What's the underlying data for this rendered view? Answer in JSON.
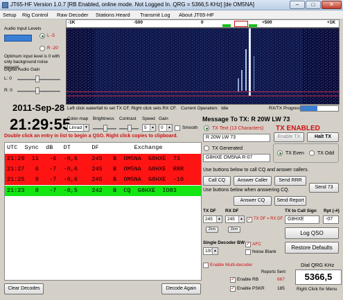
{
  "window": {
    "title": "JT65-HF Version 1.0.7  [RB Enabled, online mode.  Not Logged In.  QRG = 5366,5 KHz] [de OM5NA]",
    "minimize": "‒",
    "maximize": "□",
    "close": "✕"
  },
  "menu": [
    "Setup",
    "Rig Control",
    "Raw Decoder",
    "Stations Heard",
    "Transmit Log",
    "About JT65-HF"
  ],
  "audio": {
    "section_label": "Audio Input Levels",
    "left_label": "L -5",
    "right_label": "R -20",
    "hint": "Optimum input level is 0 with only background noise present.",
    "digital_gain_label": "Digital Audio Gain",
    "l_label": "L: 0",
    "r_label": "R: 0"
  },
  "clock": {
    "date": "2011-Sep-28",
    "time": "21:29:55"
  },
  "waterfall": {
    "ticks": [
      "-1K",
      "-500",
      "0",
      "+500",
      "+1K"
    ],
    "hint": "Left click waterfall to set TX CF, Right click sets RX CF.",
    "operation_label": "Current Operation:",
    "operation_value": "Idle",
    "progress_label": "RX/TX Progress",
    "progress": 0.45
  },
  "controls": {
    "colormap_label": "Color-map",
    "colormap_value": "Linrad",
    "brightness_label": "Brightness",
    "contrast_label": "Contrast",
    "speed_label": "Speed",
    "speed_value": "5",
    "gain_label": "Gain",
    "gain_value": "0",
    "smooth_label": "Smooth"
  },
  "decode": {
    "hint": "Double click an entry in list to begin a QSO.  Right click copies to clipboard.",
    "columns": "UTC  Sync  dB   DT      DF          Exchange",
    "rows": [
      {
        "text": "21:29  11   -6  -0,6    245   B  OM5NA  G8HXE  73",
        "color": "#ff1414"
      },
      {
        "text": "21:27   6   -7  -0,6    245   B  OM5NA  G8HXE  RRR",
        "color": "#ff1414"
      },
      {
        "text": "21:25   9   -7  -0,6    245   B  OM5NA  G8HXE  -10",
        "color": "#ff1414"
      },
      {
        "text": "21:23   8   -7  -0,5    242   B  CQ  G8HXE  IO83",
        "color": "#14e614"
      }
    ],
    "clear_button": "Clear Decodes",
    "decode_again_button": "Decode Again"
  },
  "message": {
    "title": "Message To TX: R 20W LW 73",
    "tx_text_label": "TX Text (13 Characters)",
    "tx_enabled": "TX ENABLED",
    "tx_text_value": "R 20W LW 73",
    "enable_tx_button": "Enable TX",
    "halt_tx_button": "Halt TX",
    "tx_generated_label": "TX Generated",
    "tx_generated_value": "G8HXE OM5NA R-07",
    "tx_even": "TX Even",
    "tx_odd": "TX Odd",
    "call_hint": "Use buttons below to call CQ and answer callers.",
    "call_cq": "Call CQ",
    "answer_caller": "Answer Caller",
    "send_rrr": "Send RRR",
    "answer_hint": "Use buttons below when answering CQ.",
    "send_73": "Send 73",
    "answer_cq": "Answer CQ",
    "send_report": "Send Report",
    "tx_df_label": "TX DF",
    "tx_df_value": "245",
    "rx_df_label": "RX DF",
    "rx_df_value": "245",
    "tx_eq_rx": "TX DF = RX DF",
    "zero": "Zero",
    "call_sign_label": "TX to Call Sign",
    "call_sign_value": "G8HXE",
    "rpt_label": "Rpt (-#)",
    "rpt_value": "-07",
    "log_qso": "Log QSO",
    "single_bw_label": "Single Decoder BW",
    "single_bw_value": "100",
    "afc_label": "AFC",
    "noise_blank_label": "Noise Blank",
    "restore_defaults": "Restore Defaults",
    "multi_decoder": "Enable Multi-decoder",
    "reports_sent": "Reports Sent",
    "enable_rb": "Enable RB",
    "rb_count": "667",
    "enable_pskr": "Enable PSKR",
    "pskr_count": "185",
    "dial_label": "Dial QRG KHz",
    "dial_value": "5366,5",
    "menu_hint": "Right Click for Menu"
  }
}
